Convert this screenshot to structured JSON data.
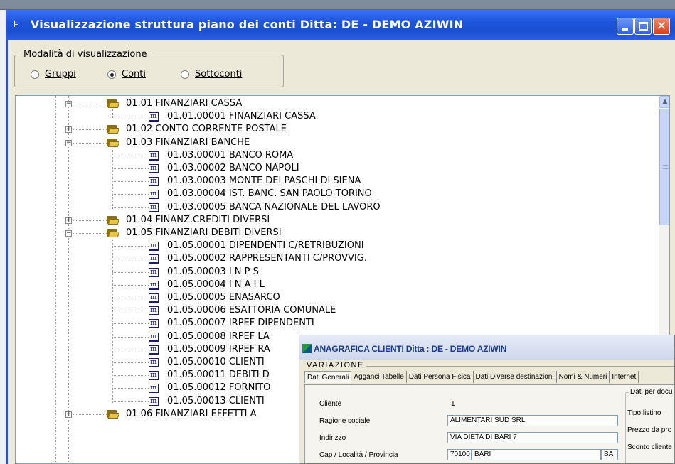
{
  "main_window": {
    "title": "Visualizzazione struttura piano dei conti  Ditta: DE - DEMO AZIWIN",
    "mode_group": {
      "legend": "Modalità di visualizzazione",
      "options": [
        "Gruppi",
        "Conti",
        "Sottoconti"
      ],
      "selected": "Conti"
    },
    "tree": [
      {
        "type": "folder",
        "expanded": true,
        "code": "01.01",
        "label": "FINANZIARI CASSA"
      },
      {
        "type": "leaf",
        "code": "01.01.00001",
        "label": "FINANZIARI CASSA"
      },
      {
        "type": "folder",
        "expanded": false,
        "code": "01.02",
        "label": "CONTO CORRENTE POSTALE"
      },
      {
        "type": "folder",
        "expanded": true,
        "code": "01.03",
        "label": "FINANZIARI BANCHE"
      },
      {
        "type": "leaf",
        "code": "01.03.00001",
        "label": "BANCO ROMA"
      },
      {
        "type": "leaf",
        "code": "01.03.00002",
        "label": "BANCO NAPOLI"
      },
      {
        "type": "leaf",
        "code": "01.03.00003",
        "label": "MONTE DEI PASCHI DI SIENA"
      },
      {
        "type": "leaf",
        "code": "01.03.00004",
        "label": "IST. BANC. SAN PAOLO TORINO"
      },
      {
        "type": "leaf",
        "code": "01.03.00005",
        "label": "BANCA NAZIONALE DEL LAVORO"
      },
      {
        "type": "folder",
        "expanded": false,
        "code": "01.04",
        "label": "FINANZ.CREDITI DIVERSI"
      },
      {
        "type": "folder",
        "expanded": true,
        "code": "01.05",
        "label": "FINANZIARI DEBITI DIVERSI"
      },
      {
        "type": "leaf",
        "code": "01.05.00001",
        "label": "DIPENDENTI C/RETRIBUZIONI"
      },
      {
        "type": "leaf",
        "code": "01.05.00002",
        "label": "RAPPRESENTANTI C/PROVVIG."
      },
      {
        "type": "leaf",
        "code": "01.05.00003",
        "label": "I N P S"
      },
      {
        "type": "leaf",
        "code": "01.05.00004",
        "label": "I N A I L"
      },
      {
        "type": "leaf",
        "code": "01.05.00005",
        "label": "ENASARCO"
      },
      {
        "type": "leaf",
        "code": "01.05.00006",
        "label": "ESATTORIA COMUNALE"
      },
      {
        "type": "leaf",
        "code": "01.05.00007",
        "label": "IRPEF DIPENDENTI"
      },
      {
        "type": "leaf",
        "code": "01.05.00008",
        "label": "IRPEF LA"
      },
      {
        "type": "leaf",
        "code": "01.05.00009",
        "label": "IRPEF RA"
      },
      {
        "type": "leaf",
        "code": "01.05.00010",
        "label": "CLIENTI"
      },
      {
        "type": "leaf",
        "code": "01.05.00011",
        "label": "DEBITI D"
      },
      {
        "type": "leaf",
        "code": "01.05.00012",
        "label": "FORNITO"
      },
      {
        "type": "leaf",
        "code": "01.05.00013",
        "label": "CLIENTI"
      },
      {
        "type": "folder",
        "expanded": false,
        "code": "01.06",
        "label": "FINANZIARI EFFETTI A"
      }
    ]
  },
  "clienti_window": {
    "title": "ANAGRAFICA CLIENTI  Ditta : DE - DEMO AZIWIN",
    "section_legend": "VARIAZIONE",
    "tabs": [
      "Dati Generali",
      "Agganci Tabelle",
      "Dati Persona Fisica",
      "Dati Diverse destinazioni",
      "Nomi & Numeri",
      "Internet"
    ],
    "active_tab": "Dati Generali",
    "fields": {
      "cliente_label": "Cliente",
      "cliente_value": "1",
      "ragione_label": "Ragione sociale",
      "ragione_value": "ALIMENTARI SUD SRL",
      "indirizzo_label": "Indirizzo",
      "indirizzo_value": "VIA DIETA DI BARI 7",
      "cap_label": "Cap / Località / Provincia",
      "cap_value": "70100",
      "localita_value": "BARI",
      "provincia_value": "BA"
    },
    "right_group": {
      "legend": "Dati per docu",
      "rows": [
        "Tipo listino",
        "Prezzo da pro",
        "Sconto cliente"
      ]
    }
  },
  "colors": {
    "xp_title_blue": "#1d55dd",
    "window_face": "#ece9d8",
    "tree_bg": "#ffffff"
  }
}
